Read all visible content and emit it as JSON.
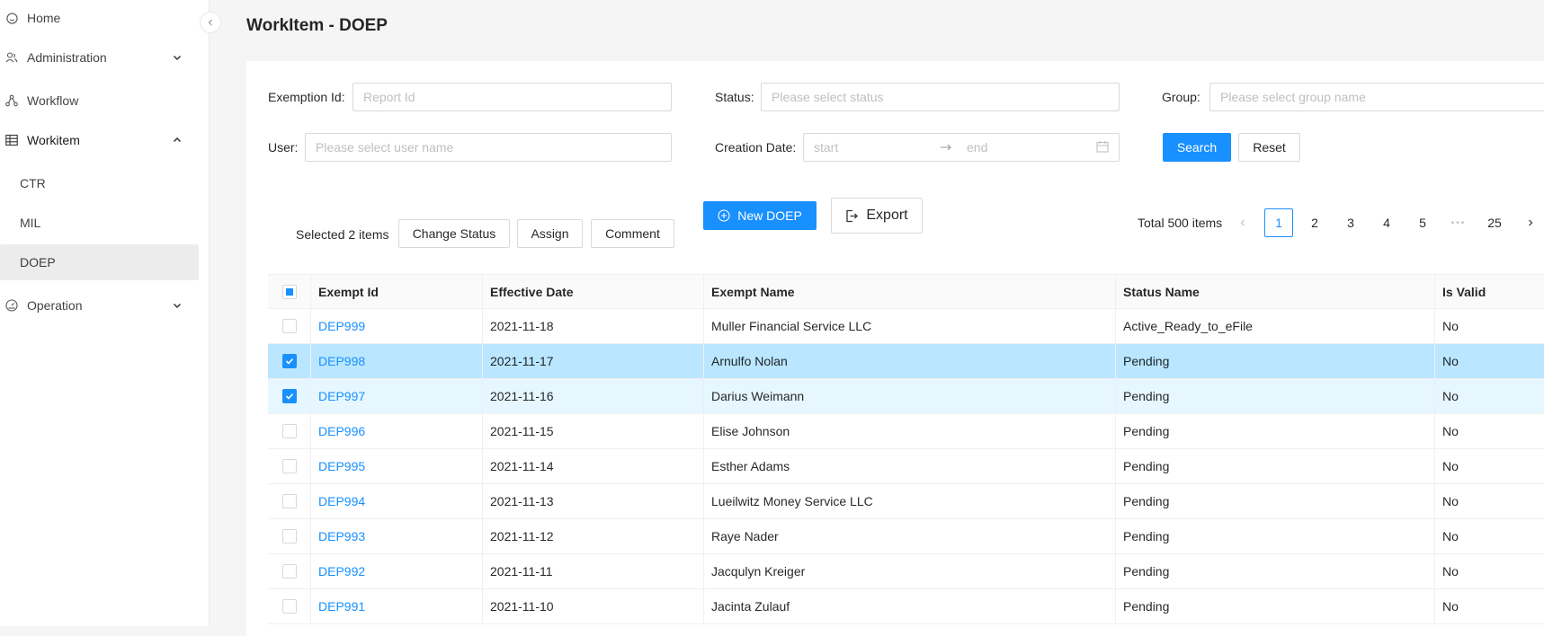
{
  "sidebar": {
    "items": [
      {
        "label": "Home",
        "icon": "smile-icon"
      },
      {
        "label": "Administration",
        "icon": "users-icon",
        "expanded": false
      },
      {
        "label": "Workflow",
        "icon": "workflow-icon"
      },
      {
        "label": "Workitem",
        "icon": "table-icon",
        "expanded": true
      },
      {
        "label": "Operation",
        "icon": "dashboard-icon",
        "expanded": false
      }
    ],
    "sub_items": [
      {
        "label": "CTR"
      },
      {
        "label": "MIL"
      },
      {
        "label": "DOEP",
        "active": true
      }
    ]
  },
  "page": {
    "title": "WorkItem - DOEP"
  },
  "filters": {
    "exemption_id": {
      "label": "Exemption Id:",
      "placeholder": "Report Id"
    },
    "status": {
      "label": "Status:",
      "placeholder": "Please select status"
    },
    "group": {
      "label": "Group:",
      "placeholder": "Please select group name"
    },
    "user": {
      "label": "User:",
      "placeholder": "Please select user name"
    },
    "creation_date": {
      "label": "Creation Date:",
      "start_placeholder": "start",
      "end_placeholder": "end"
    },
    "search_label": "Search",
    "reset_label": "Reset"
  },
  "actions": {
    "selected_text": "Selected 2 items",
    "change_status_label": "Change Status",
    "assign_label": "Assign",
    "comment_label": "Comment",
    "new_label": "New DOEP",
    "export_label": "Export"
  },
  "pagination": {
    "total_text": "Total 500 items",
    "pages": [
      "1",
      "2",
      "3",
      "4",
      "5"
    ],
    "ellipsis": "•••",
    "last_page": "25",
    "current": "1"
  },
  "table": {
    "columns": [
      "Exempt Id",
      "Effective Date",
      "Exempt Name",
      "Status Name",
      "Is Valid"
    ],
    "rows": [
      {
        "id": "DEP999",
        "date": "2021-11-18",
        "name": "Muller Financial Service LLC",
        "status": "Active_Ready_to_eFile",
        "valid": "No",
        "checked": false
      },
      {
        "id": "DEP998",
        "date": "2021-11-17",
        "name": "Arnulfo Nolan",
        "status": "Pending",
        "valid": "No",
        "checked": true
      },
      {
        "id": "DEP997",
        "date": "2021-11-16",
        "name": "Darius Weimann",
        "status": "Pending",
        "valid": "No",
        "checked": true
      },
      {
        "id": "DEP996",
        "date": "2021-11-15",
        "name": "Elise Johnson",
        "status": "Pending",
        "valid": "No",
        "checked": false
      },
      {
        "id": "DEP995",
        "date": "2021-11-14",
        "name": "Esther Adams",
        "status": "Pending",
        "valid": "No",
        "checked": false
      },
      {
        "id": "DEP994",
        "date": "2021-11-13",
        "name": "Lueilwitz Money Service LLC",
        "status": "Pending",
        "valid": "No",
        "checked": false
      },
      {
        "id": "DEP993",
        "date": "2021-11-12",
        "name": "Raye Nader",
        "status": "Pending",
        "valid": "No",
        "checked": false
      },
      {
        "id": "DEP992",
        "date": "2021-11-11",
        "name": "Jacqulyn Kreiger",
        "status": "Pending",
        "valid": "No",
        "checked": false
      },
      {
        "id": "DEP991",
        "date": "2021-11-10",
        "name": "Jacinta Zulauf",
        "status": "Pending",
        "valid": "No",
        "checked": false
      }
    ]
  },
  "colors": {
    "primary": "#1890ff",
    "selected_row": "#bae7ff",
    "selected_row_light": "#e6f7ff"
  }
}
